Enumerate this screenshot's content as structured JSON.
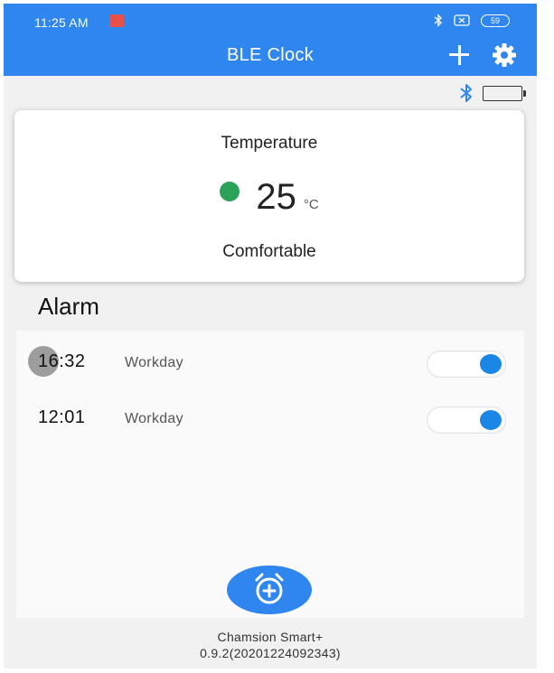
{
  "status_bar": {
    "time": "11:25 AM",
    "battery_level": "59"
  },
  "header": {
    "title": "BLE Clock",
    "add_icon": "plus-icon",
    "settings_icon": "gear-icon",
    "background_color": "#2f86ee"
  },
  "device": {
    "connection_icon": "bluetooth-icon",
    "battery_icon": "battery-icon"
  },
  "temperature_card": {
    "label": "Temperature",
    "value": "25",
    "unit": "°C",
    "status": "Comfortable",
    "status_dot_color": "#2aa257"
  },
  "alarms": {
    "heading": "Alarm",
    "items": [
      {
        "time": "16:32",
        "repeat": "Workday",
        "enabled": true
      },
      {
        "time": "12:01",
        "repeat": "Workday",
        "enabled": true
      }
    ],
    "add_icon": "alarm-add-icon"
  },
  "footer": {
    "app_name": "Chamsion Smart+",
    "version": "0.9.2(20201224092343)"
  }
}
